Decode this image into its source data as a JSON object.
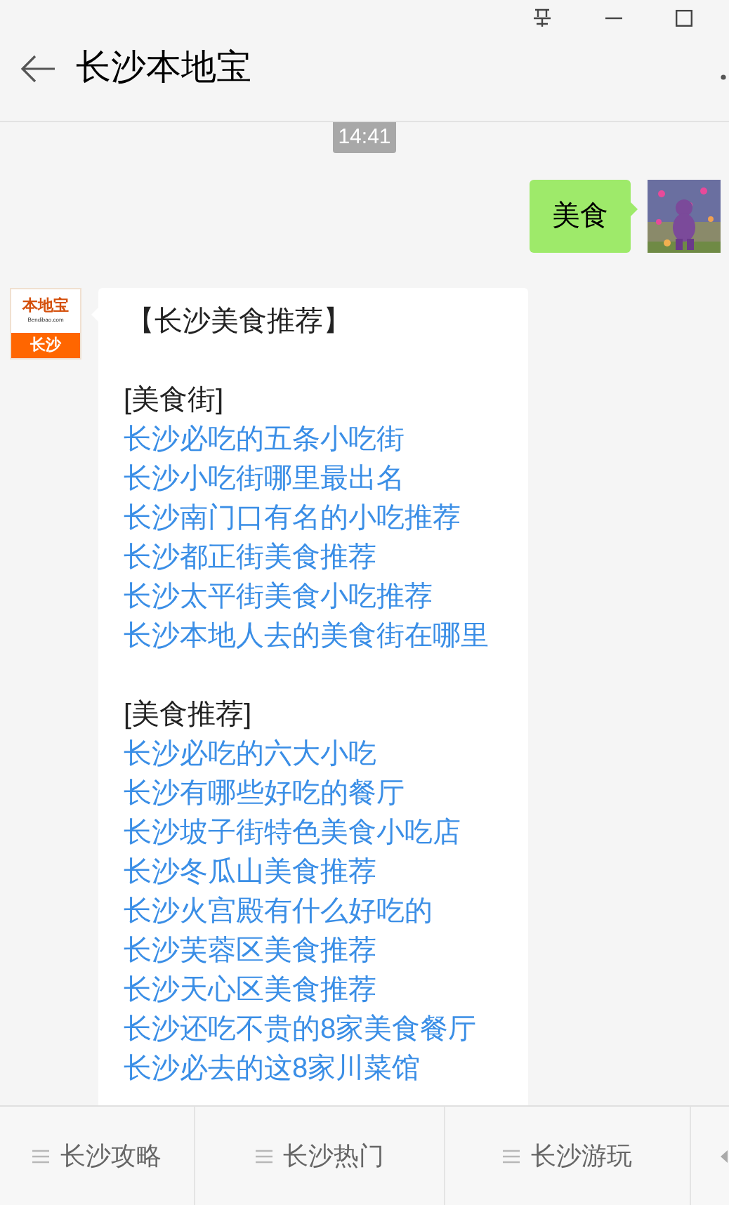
{
  "header": {
    "title": "长沙本地宝"
  },
  "chat": {
    "time": "14:41",
    "outgoing": {
      "text": "美食"
    },
    "incoming": {
      "logo": {
        "brand": "本地宝",
        "site": "Bendibao.com",
        "city": "长沙"
      },
      "heading": "【长沙美食推荐】",
      "sections": [
        {
          "title": "[美食街]",
          "links": [
            "长沙必吃的五条小吃街",
            "长沙小吃街哪里最出名",
            "长沙南门口有名的小吃推荐",
            "长沙都正街美食推荐",
            "长沙太平街美食小吃推荐",
            "长沙本地人去的美食街在哪里"
          ]
        },
        {
          "title": "[美食推荐]",
          "links": [
            "长沙必吃的六大小吃",
            "长沙有哪些好吃的餐厅",
            "长沙坡子街特色美食小吃店",
            "长沙冬瓜山美食推荐",
            "长沙火宫殿有什么好吃的",
            "长沙芙蓉区美食推荐",
            "长沙天心区美食推荐",
            "长沙还吃不贵的8家美食餐厅",
            "长沙必去的这8家川菜馆"
          ]
        }
      ]
    }
  },
  "menu_bar": {
    "items": [
      {
        "label": "长沙攻略"
      },
      {
        "label": "长沙热门"
      },
      {
        "label": "长沙游玩"
      }
    ]
  }
}
